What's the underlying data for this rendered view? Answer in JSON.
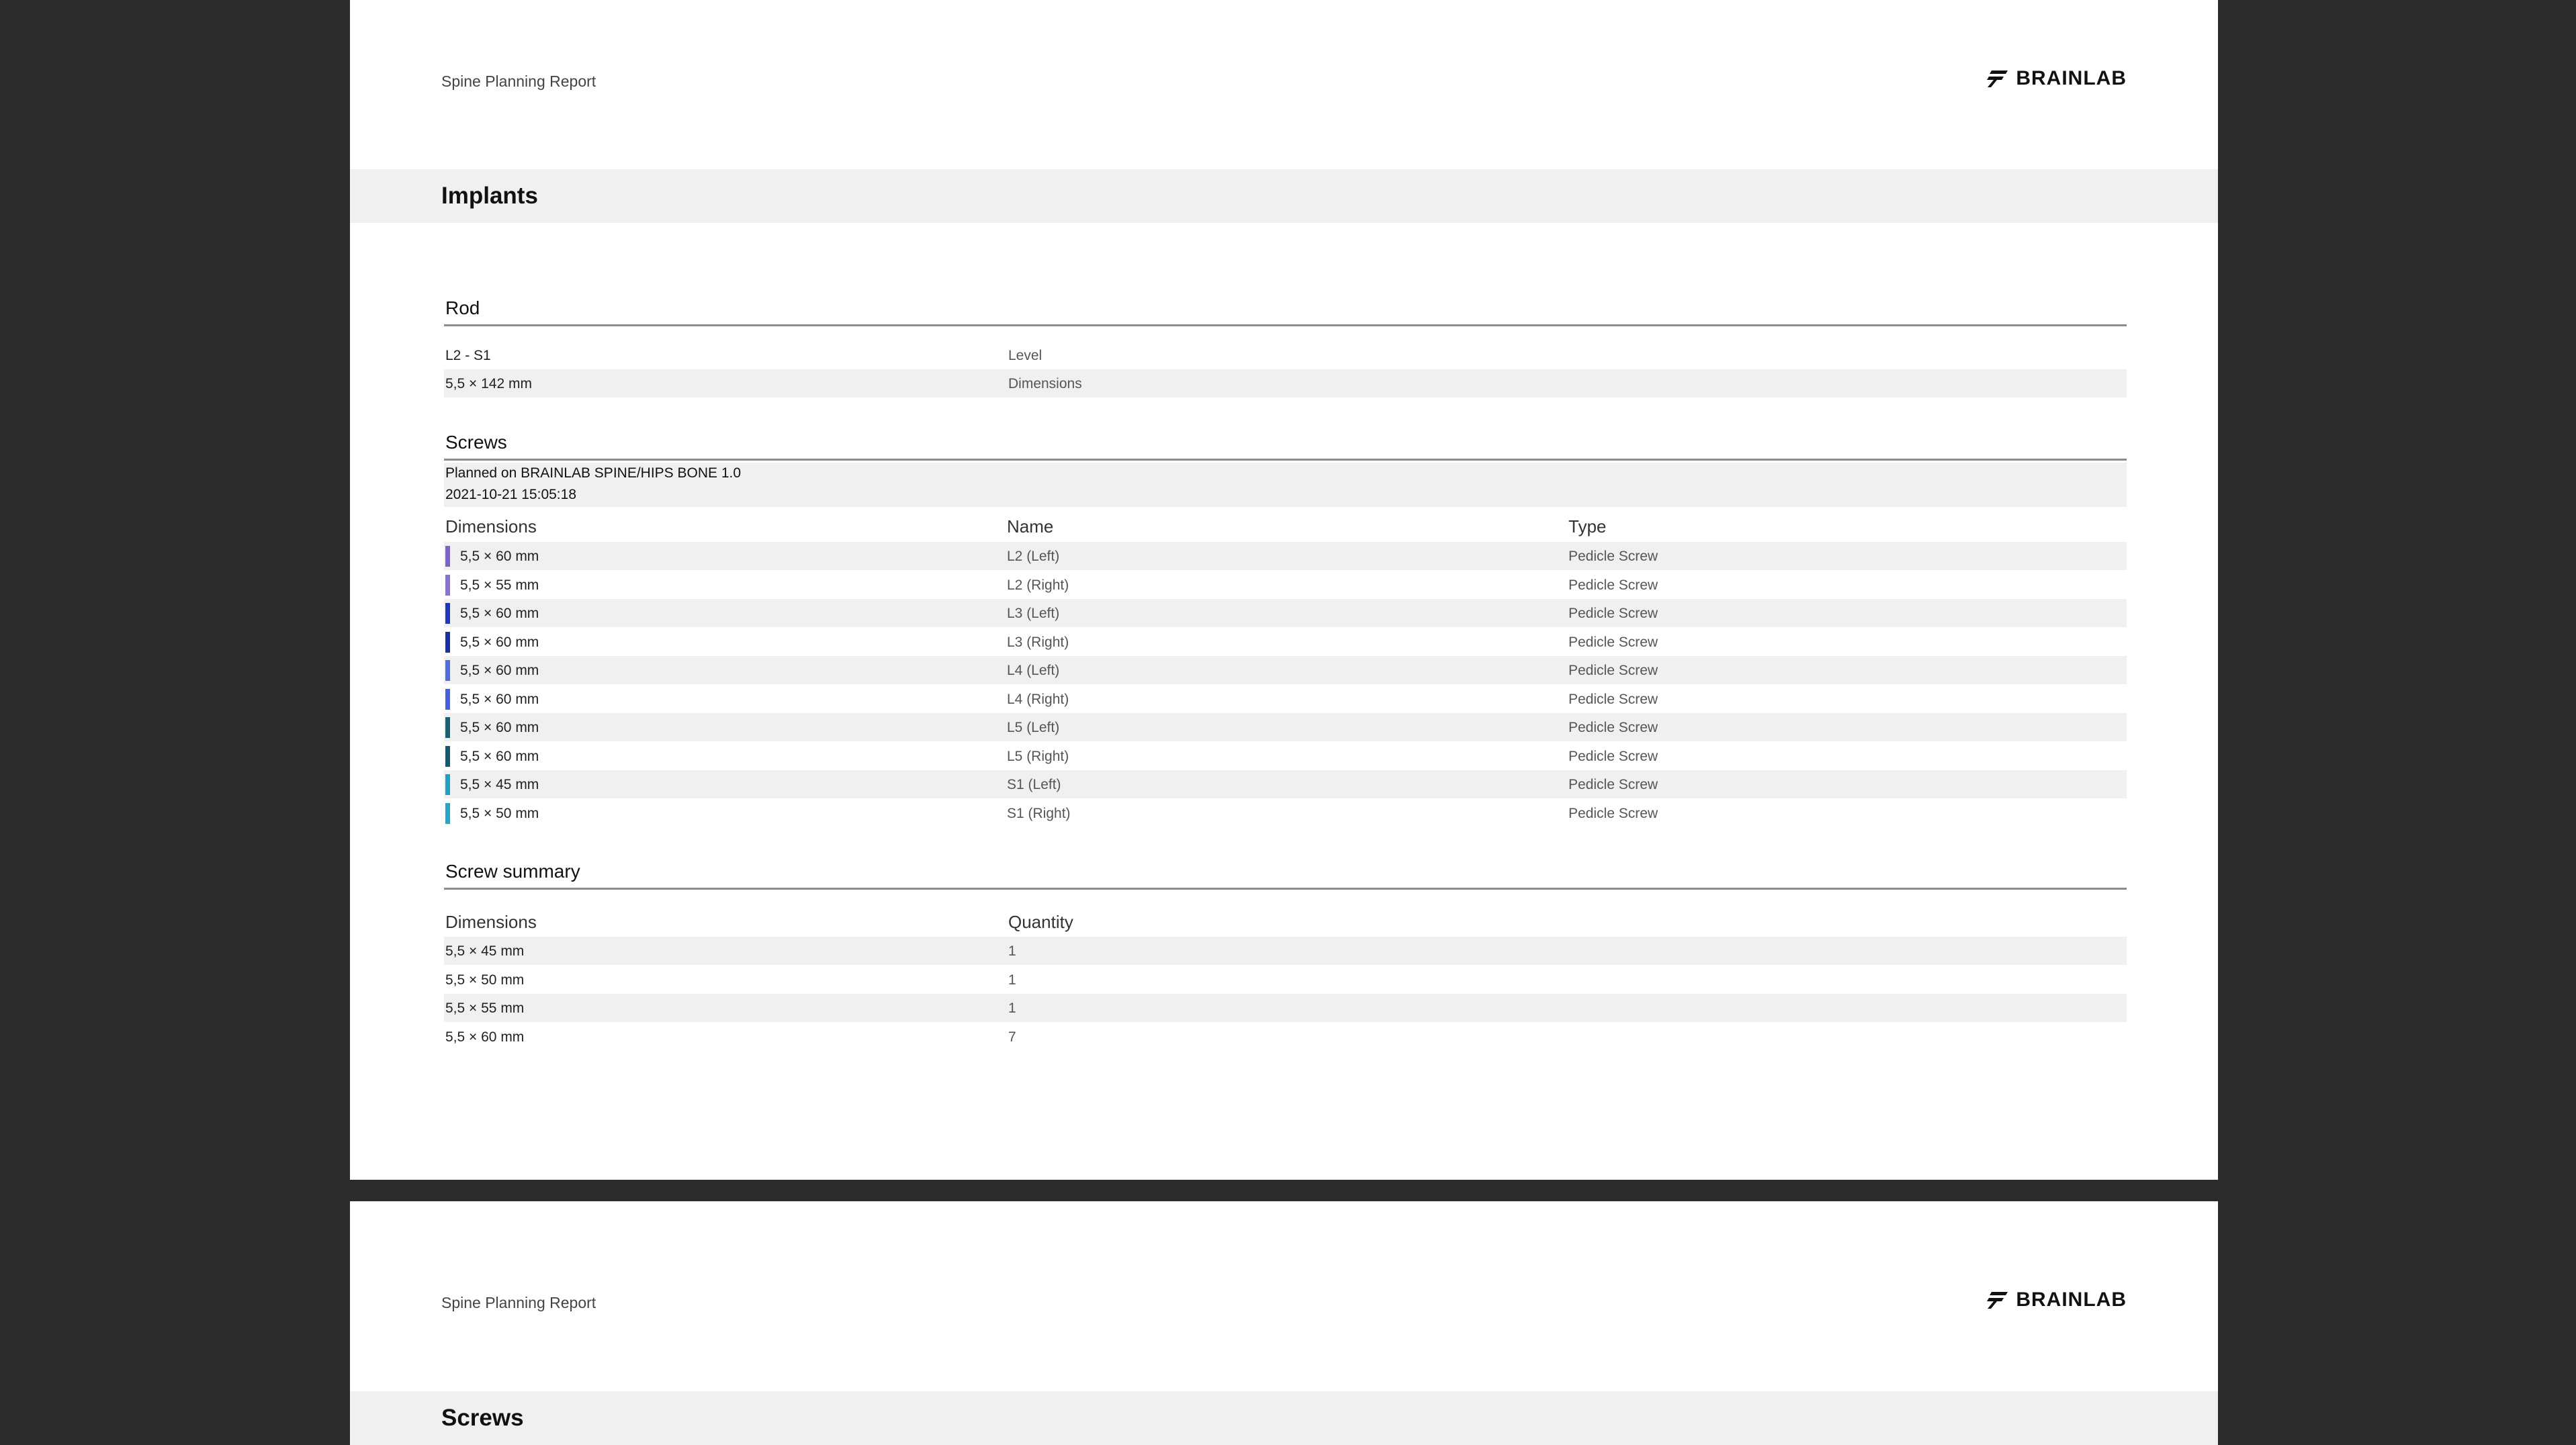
{
  "report_title": "Spine Planning Report",
  "brand_name": "BRAINLAB",
  "page1": {
    "section_title": "Implants",
    "rod": {
      "title": "Rod",
      "rows": [
        {
          "value": "L2 - S1",
          "label": "Level"
        },
        {
          "value": "5,5 × 142 mm",
          "label": "Dimensions"
        }
      ]
    },
    "screws": {
      "title": "Screws",
      "planned_line1": "Planned on BRAINLAB SPINE/HIPS BONE 1.0",
      "planned_line2": "2021-10-21 15:05:18",
      "headers": {
        "dimensions": "Dimensions",
        "name": "Name",
        "type": "Type"
      },
      "rows": [
        {
          "dimensions": "5,5 × 60 mm",
          "name": "L2 (Left)",
          "type": "Pedicle Screw",
          "color": "#7b61d1"
        },
        {
          "dimensions": "5,5 × 55 mm",
          "name": "L2 (Right)",
          "type": "Pedicle Screw",
          "color": "#8a6fd8"
        },
        {
          "dimensions": "5,5 × 60 mm",
          "name": "L3 (Left)",
          "type": "Pedicle Screw",
          "color": "#1f35c4"
        },
        {
          "dimensions": "5,5 × 60 mm",
          "name": "L3 (Right)",
          "type": "Pedicle Screw",
          "color": "#1a2fb0"
        },
        {
          "dimensions": "5,5 × 60 mm",
          "name": "L4 (Left)",
          "type": "Pedicle Screw",
          "color": "#4c6de6"
        },
        {
          "dimensions": "5,5 × 60 mm",
          "name": "L4 (Right)",
          "type": "Pedicle Screw",
          "color": "#3f61e3"
        },
        {
          "dimensions": "5,5 × 60 mm",
          "name": "L5 (Left)",
          "type": "Pedicle Screw",
          "color": "#14627a"
        },
        {
          "dimensions": "5,5 × 60 mm",
          "name": "L5 (Right)",
          "type": "Pedicle Screw",
          "color": "#0f5b73"
        },
        {
          "dimensions": "5,5 × 45 mm",
          "name": "S1 (Left)",
          "type": "Pedicle Screw",
          "color": "#1aa3c8"
        },
        {
          "dimensions": "5,5 × 50 mm",
          "name": "S1 (Right)",
          "type": "Pedicle Screw",
          "color": "#20a9cf"
        }
      ]
    },
    "summary": {
      "title": "Screw summary",
      "headers": {
        "dimensions": "Dimensions",
        "quantity": "Quantity"
      },
      "rows": [
        {
          "dimensions": "5,5 × 45 mm",
          "quantity": "1"
        },
        {
          "dimensions": "5,5 × 50 mm",
          "quantity": "1"
        },
        {
          "dimensions": "5,5 × 55 mm",
          "quantity": "1"
        },
        {
          "dimensions": "5,5 × 60 mm",
          "quantity": "7"
        }
      ]
    }
  },
  "page2": {
    "section_title": "Screws"
  }
}
